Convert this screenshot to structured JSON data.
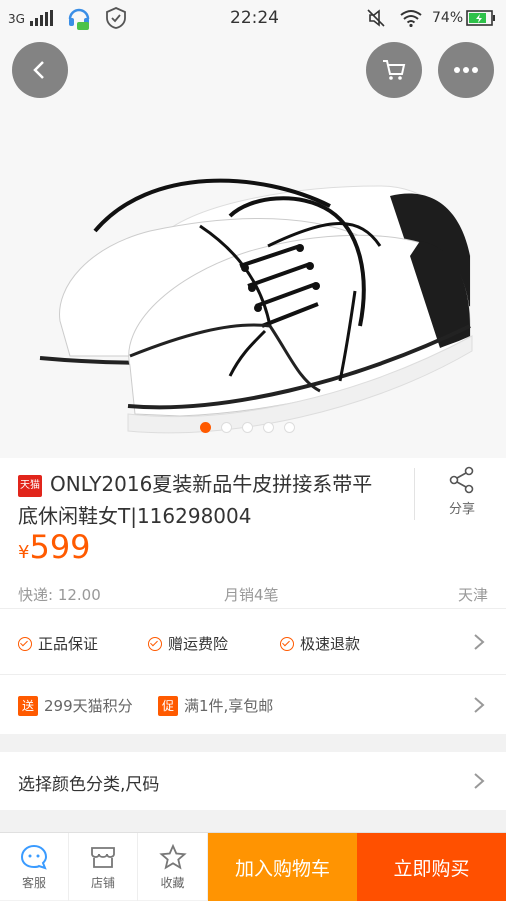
{
  "status_bar": {
    "network": "3G",
    "time": "22:24",
    "battery": "74%",
    "icons": [
      "signal-icon",
      "headset-icon",
      "shield-icon",
      "mute-icon",
      "wifi-icon",
      "battery-icon"
    ]
  },
  "hero": {
    "image": "shoe-photo",
    "nav_icons": [
      "back-icon",
      "cart-icon",
      "more-icon"
    ],
    "dots_count": 5,
    "active_dot": 0
  },
  "product": {
    "badge": "天猫",
    "title": "ONLY2016夏装新品牛皮拼接系带平底休闲鞋女T|116298004",
    "share_label": "分享",
    "price_symbol": "¥",
    "price": "599",
    "shipping": "快递: 12.00",
    "monthly_sales": "月销4笔",
    "location": "天津"
  },
  "guarantees": [
    "正品保证",
    "赠运费险",
    "极速退款"
  ],
  "promotions": [
    {
      "tag": "送",
      "text": "299天猫积分"
    },
    {
      "tag": "促",
      "text": "满1件,享包邮"
    }
  ],
  "select_label": "选择颜色分类,尺码",
  "bottom_bar": {
    "service": "客服",
    "shop": "店铺",
    "favorite": "收藏",
    "add_to_cart": "加入购物车",
    "buy_now": "立即购买"
  },
  "colors": {
    "accent": "#ff5a00",
    "cart_button": "#ff9402",
    "buy_button": "#ff5000",
    "tmall_red": "#e1251b"
  }
}
